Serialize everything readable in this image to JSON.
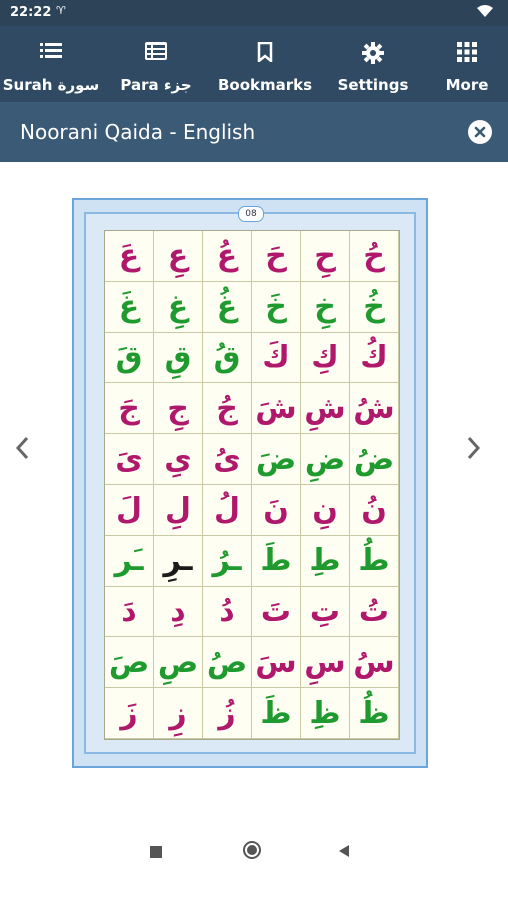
{
  "status": {
    "time": "22:22",
    "notification_glyph": "♈",
    "wifi_icon": "wifi-icon"
  },
  "toolbar": {
    "items": [
      {
        "label": "Surah سورة",
        "icon": "list-icon"
      },
      {
        "label": "Para جزء",
        "icon": "grid-list-icon"
      },
      {
        "label": "Bookmarks",
        "icon": "bookmark-icon"
      },
      {
        "label": "Settings",
        "icon": "gear-icon"
      },
      {
        "label": "More",
        "icon": "apps-icon"
      }
    ]
  },
  "header": {
    "title": "Noorani Qaida - English"
  },
  "qaida_page": {
    "page_number": "08",
    "rows": [
      [
        {
          "t": "عَ",
          "c": "m"
        },
        {
          "t": "عِ",
          "c": "m"
        },
        {
          "t": "عُ",
          "c": "m"
        },
        {
          "t": "حَ",
          "c": "m"
        },
        {
          "t": "حِ",
          "c": "m"
        },
        {
          "t": "حُ",
          "c": "m"
        }
      ],
      [
        {
          "t": "غَ",
          "c": "g"
        },
        {
          "t": "غِ",
          "c": "g"
        },
        {
          "t": "غُ",
          "c": "g"
        },
        {
          "t": "خَ",
          "c": "g"
        },
        {
          "t": "خِ",
          "c": "g"
        },
        {
          "t": "خُ",
          "c": "g"
        }
      ],
      [
        {
          "t": "قَ",
          "c": "g"
        },
        {
          "t": "قِ",
          "c": "g"
        },
        {
          "t": "قُ",
          "c": "g"
        },
        {
          "t": "كَ",
          "c": "m"
        },
        {
          "t": "كِ",
          "c": "m"
        },
        {
          "t": "كُ",
          "c": "m"
        }
      ],
      [
        {
          "t": "جَ",
          "c": "m"
        },
        {
          "t": "جِ",
          "c": "m"
        },
        {
          "t": "جُ",
          "c": "m"
        },
        {
          "t": "شَ",
          "c": "m"
        },
        {
          "t": "شِ",
          "c": "m"
        },
        {
          "t": "شُ",
          "c": "m"
        }
      ],
      [
        {
          "t": "ىَ",
          "c": "m"
        },
        {
          "t": "ىِ",
          "c": "m"
        },
        {
          "t": "ىُ",
          "c": "m"
        },
        {
          "t": "ضَ",
          "c": "g"
        },
        {
          "t": "ضِ",
          "c": "g"
        },
        {
          "t": "ضُ",
          "c": "g"
        }
      ],
      [
        {
          "t": "لَ",
          "c": "m"
        },
        {
          "t": "لِ",
          "c": "m"
        },
        {
          "t": "لُ",
          "c": "m"
        },
        {
          "t": "نَ",
          "c": "m"
        },
        {
          "t": "نِ",
          "c": "m"
        },
        {
          "t": "نُ",
          "c": "m"
        }
      ],
      [
        {
          "t": "ـَر",
          "c": "g"
        },
        {
          "t": "ـرِ",
          "c": "k"
        },
        {
          "t": "ـرُ",
          "c": "g"
        },
        {
          "t": "طَ",
          "c": "g"
        },
        {
          "t": "طِ",
          "c": "g"
        },
        {
          "t": "طُ",
          "c": "g"
        }
      ],
      [
        {
          "t": "دَ",
          "c": "m"
        },
        {
          "t": "دِ",
          "c": "m"
        },
        {
          "t": "دُ",
          "c": "m"
        },
        {
          "t": "تَ",
          "c": "m"
        },
        {
          "t": "تِ",
          "c": "m"
        },
        {
          "t": "تُ",
          "c": "m"
        }
      ],
      [
        {
          "t": "صَ",
          "c": "g"
        },
        {
          "t": "صِ",
          "c": "g"
        },
        {
          "t": "صُ",
          "c": "g"
        },
        {
          "t": "سَ",
          "c": "m"
        },
        {
          "t": "سِ",
          "c": "m"
        },
        {
          "t": "سُ",
          "c": "m"
        }
      ],
      [
        {
          "t": "زَ",
          "c": "m"
        },
        {
          "t": "زِ",
          "c": "m"
        },
        {
          "t": "زُ",
          "c": "m"
        },
        {
          "t": "ظَ",
          "c": "g"
        },
        {
          "t": "ظِ",
          "c": "g"
        },
        {
          "t": "ظُ",
          "c": "g"
        }
      ]
    ]
  },
  "navigation": {
    "prev_icon": "chevron-left-icon",
    "next_icon": "chevron-right-icon"
  },
  "system_nav": {
    "recents_icon": "square-icon",
    "home_icon": "circle-icon",
    "back_icon": "triangle-back-icon"
  },
  "colors": {
    "status_bar": "#2d4458",
    "toolbar": "#2f4a62",
    "title_bar": "#3a5a75",
    "magenta": "#b0186c",
    "green": "#1f9a2e"
  }
}
